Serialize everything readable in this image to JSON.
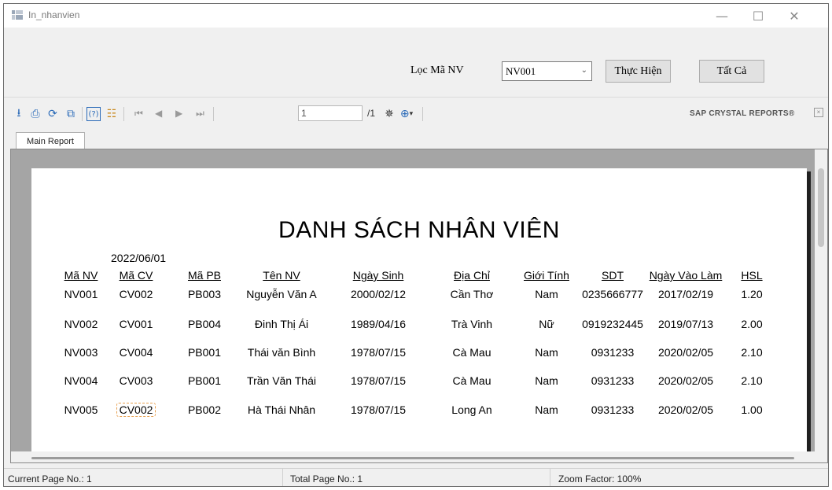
{
  "window": {
    "title": "In_nhanvien",
    "minimize_icon": "minimize-icon",
    "maximize_icon": "maximize-icon",
    "close_icon": "close-icon"
  },
  "filter": {
    "label": "Lọc Mã NV",
    "selected": "NV001",
    "run_button": "Thực Hiện",
    "all_button": "Tất Cả"
  },
  "toolbar": {
    "icons": [
      "export-icon",
      "print-icon",
      "refresh-icon",
      "copy-icon",
      "help-icon",
      "group-tree-icon"
    ],
    "nav_icons": [
      "first-page-icon",
      "previous-page-icon",
      "next-page-icon",
      "last-page-icon"
    ],
    "page_value": "1",
    "page_total": "/1",
    "search_icon": "binoculars-icon",
    "zoom_icon": "zoom-icon",
    "brand": "SAP CRYSTAL REPORTS®"
  },
  "tabs": [
    "Main Report"
  ],
  "report": {
    "title": "DANH SÁCH NHÂN VIÊN",
    "date": "2022/06/01",
    "columns": [
      "Mã NV",
      "Mã CV",
      "Mã PB",
      "Tên NV",
      "Ngày Sinh",
      "Địa Chỉ",
      "Giới Tính",
      "SDT",
      "Ngày Vào Làm",
      "HSL"
    ],
    "rows": [
      [
        "NV001",
        "CV002",
        "PB003",
        "Nguyễn Văn A",
        "2000/02/12",
        "Cần Thơ",
        "Nam",
        "0235666777",
        "2017/02/19",
        "1.20"
      ],
      [
        "NV002",
        "CV001",
        "PB004",
        "Đinh Thị Ái",
        "1989/04/16",
        "Trà Vinh",
        "Nữ",
        "0919232445",
        "2019/07/13",
        "2.00"
      ],
      [
        "NV003",
        "CV004",
        "PB001",
        "Thái văn Bình",
        "1978/07/15",
        "Cà Mau",
        "Nam",
        "0931233",
        "2020/02/05",
        "2.10"
      ],
      [
        "NV004",
        "CV003",
        "PB001",
        "Trần Văn Thái",
        "1978/07/15",
        "Cà Mau",
        "Nam",
        "0931233",
        "2020/02/05",
        "2.10"
      ],
      [
        "NV005",
        "CV002",
        "PB002",
        "Hà Thái Nhân",
        "1978/07/15",
        "Long An",
        "Nam",
        "0931233",
        "2020/02/05",
        "1.00"
      ]
    ]
  },
  "status": {
    "current_page": "Current Page No.: 1",
    "total_page": "Total Page No.: 1",
    "zoom": "Zoom Factor: 100%"
  }
}
